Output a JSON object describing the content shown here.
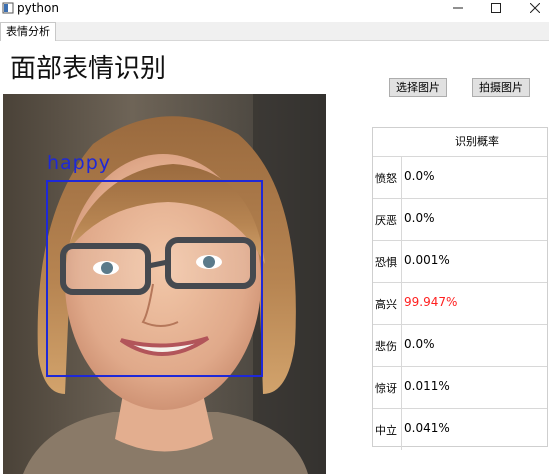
{
  "window": {
    "title": "python"
  },
  "tabs": [
    {
      "label": "表情分析"
    }
  ],
  "page": {
    "title": "面部表情识别"
  },
  "buttons": {
    "select_image": "选择图片",
    "take_photo": "拍摄图片"
  },
  "detection": {
    "label": "happy",
    "box_color": "#1e28d8"
  },
  "probability_table": {
    "header": "识别概率",
    "highlight_color": "#ff2020",
    "rows": [
      {
        "emotion": "愤怒",
        "value": "0.0%"
      },
      {
        "emotion": "厌恶",
        "value": "0.0%"
      },
      {
        "emotion": "恐惧",
        "value": "0.001%"
      },
      {
        "emotion": "高兴",
        "value": "99.947%",
        "highlight": true
      },
      {
        "emotion": "悲伤",
        "value": "0.0%"
      },
      {
        "emotion": "惊讶",
        "value": "0.011%"
      },
      {
        "emotion": "中立",
        "value": "0.041%"
      }
    ]
  }
}
